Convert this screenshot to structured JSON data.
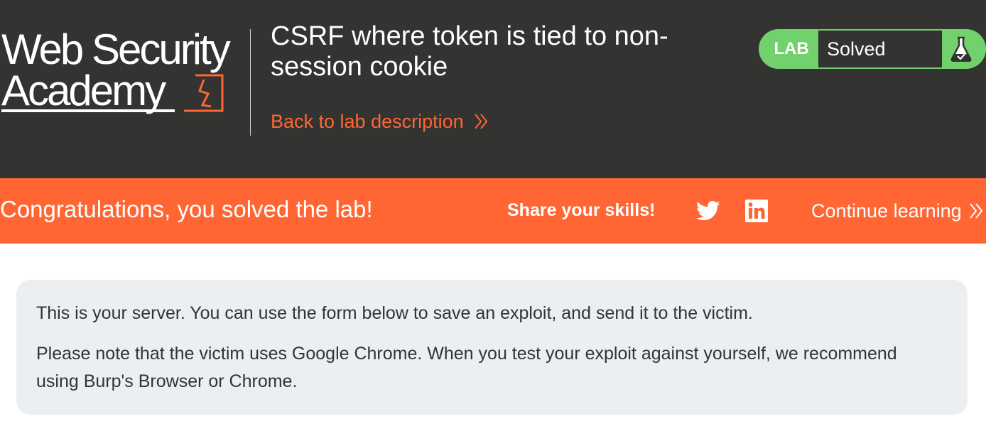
{
  "logo": {
    "line1": "Web Security",
    "line2": "Academy",
    "mark_icon": "academy-bolt-icon"
  },
  "header": {
    "title": "CSRF where token is tied to non-session cookie",
    "back_link": "Back to lab description",
    "back_icon": "double-chevron-right-icon"
  },
  "lab_status": {
    "badge": "LAB",
    "state": "Solved",
    "icon": "flask-check-icon"
  },
  "banner": {
    "message": "Congratulations, you solved the lab!",
    "share_label": "Share your skills!",
    "share_icons": [
      "twitter-icon",
      "linkedin-icon"
    ],
    "continue_link": "Continue learning"
  },
  "info": {
    "paragraph1": "This is your server. You can use the form below to save an exploit, and send it to the victim.",
    "paragraph2": "Please note that the victim uses Google Chrome. When you test your exploit against yourself, we recommend using Burp's Browser or Chrome."
  },
  "colors": {
    "header_bg": "#333332",
    "accent_orange": "#ff6633",
    "solved_green": "#70d16d",
    "info_bg": "#ebeff2",
    "text_dark": "#333332"
  }
}
